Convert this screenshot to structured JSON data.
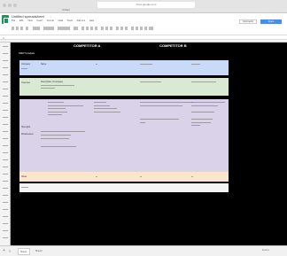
{
  "browser": {
    "url": "docs.google.com",
    "tab_title": "Untitled"
  },
  "app": {
    "doc_title": "Untitled spreadsheet",
    "menus": [
      "File",
      "Edit",
      "View",
      "Insert",
      "Format",
      "Data",
      "Tools",
      "Add-ons",
      "Help"
    ],
    "user": "",
    "comments_label": "Comments",
    "share_label": "Share"
  },
  "formula_bar": {
    "fx": "fx",
    "value": ""
  },
  "grid": {
    "columns": [
      "COMPETITOR A",
      "COMPETITOR B"
    ],
    "title": "SWOT Analysis",
    "section_label": "SWOT",
    "rows": {
      "r1_label": "Company",
      "r1_a": "Name",
      "r2_label": "Overview",
      "r2_a": "Description of company",
      "r3_label": "Strengths",
      "r4_label": "Weaknesses",
      "r5_label": "Notes"
    }
  },
  "sheet_tabs": [
    "Sheet1",
    "Sheet2"
  ],
  "explore_label": "Explore"
}
